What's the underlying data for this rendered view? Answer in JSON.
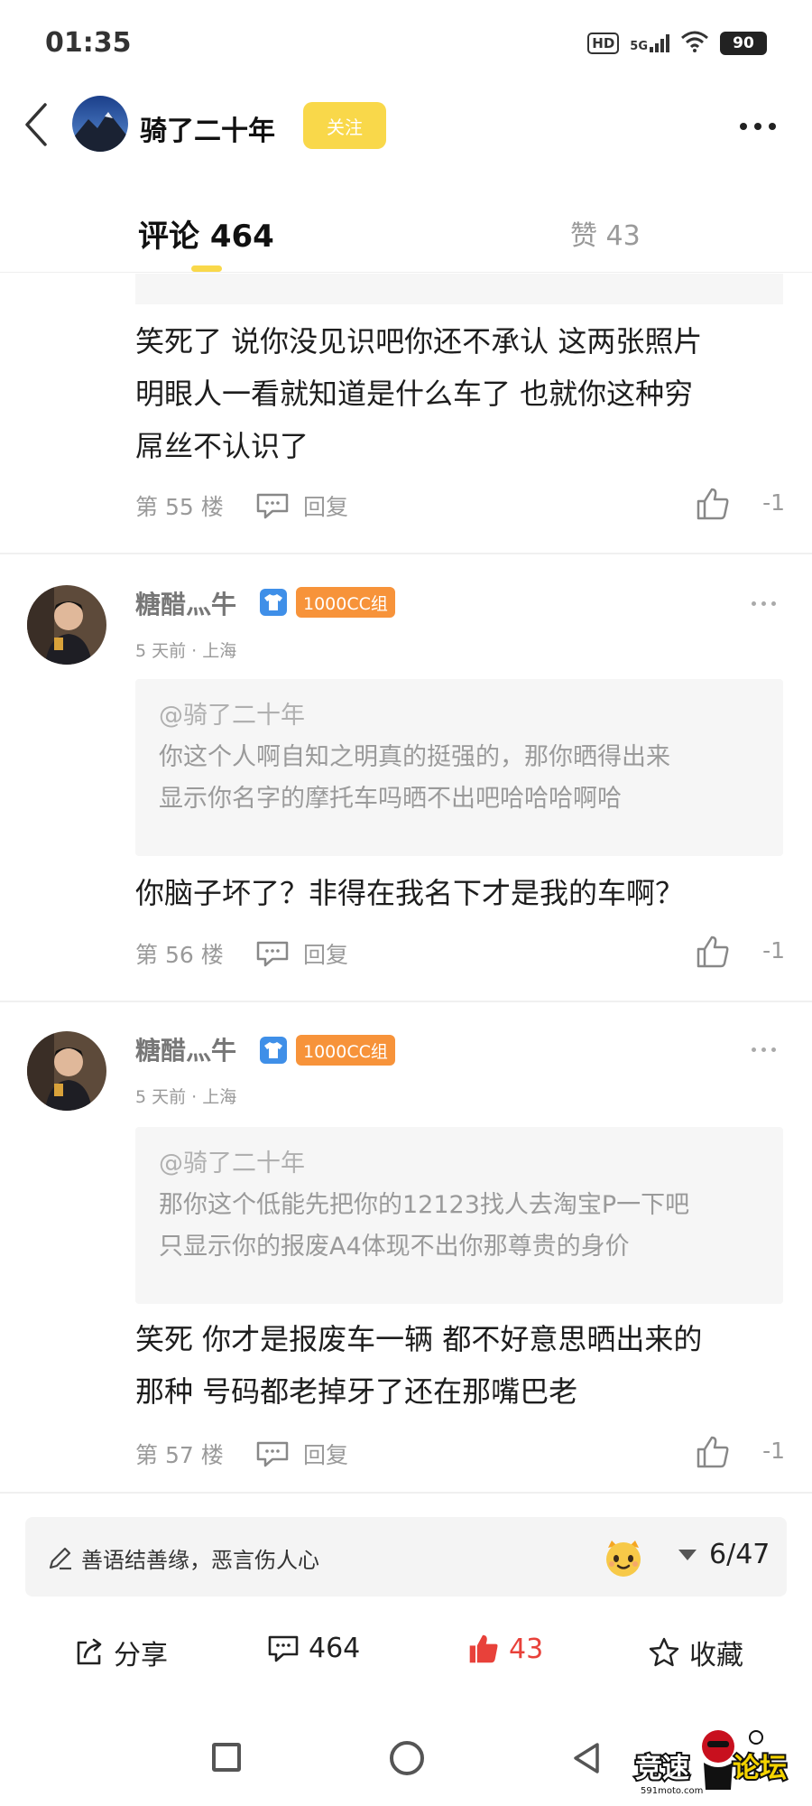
{
  "status_bar": {
    "time": "01:35",
    "hd": "HD",
    "network": "5G",
    "battery": "90"
  },
  "header": {
    "title": "骑了二十年",
    "follow_label": "关注"
  },
  "tabs": {
    "comments_label": "评论 464",
    "likes_label": "赞 43"
  },
  "comments": [
    {
      "body_lines": [
        "笑死了 说你没见识吧你还不承认 这两张照片",
        "明眼人一看就知道是什么车了 也就你这种穷",
        "屌丝不认识了"
      ],
      "floor": "第 55 楼",
      "reply_label": "回复",
      "likes": "-1"
    },
    {
      "username": "糖醋灬牛",
      "badge": "1000CC组",
      "meta": "5 天前 · 上海",
      "quote_to": "@骑了二十年",
      "quote_lines": [
        "你这个人啊自知之明真的挺强的，那你晒得出来",
        "显示你名字的摩托车吗晒不出吧哈哈哈啊哈"
      ],
      "body_lines": [
        "你脑子坏了？非得在我名下才是我的车啊？"
      ],
      "floor": "第 56 楼",
      "reply_label": "回复",
      "likes": "-1"
    },
    {
      "username": "糖醋灬牛",
      "badge": "1000CC组",
      "meta": "5 天前 · 上海",
      "quote_to": "@骑了二十年",
      "quote_lines": [
        "那你这个低能先把你的12123找人去淘宝P一下吧",
        "只显示你的报废A4体现不出你那尊贵的身价"
      ],
      "body_lines": [
        "笑死 你才是报废车一辆 都不好意思晒出来的",
        "那种 号码都老掉牙了还在那嘴巴老"
      ],
      "floor": "第 57 楼",
      "reply_label": "回复",
      "likes": "-1"
    }
  ],
  "input_bar": {
    "placeholder": "善语结善缘，恶言伤人心",
    "page_counter": "6/47"
  },
  "actions": {
    "share": "分享",
    "comments": "464",
    "likes": "43",
    "favorite": "收藏"
  },
  "colors": {
    "accent": "#f9d84a",
    "like_red": "#e8413a",
    "badge_orange": "#f7933a",
    "badge_blue": "#3f8fe8"
  },
  "watermark": {
    "brand": "竞速论坛",
    "site": "591moto.com"
  }
}
